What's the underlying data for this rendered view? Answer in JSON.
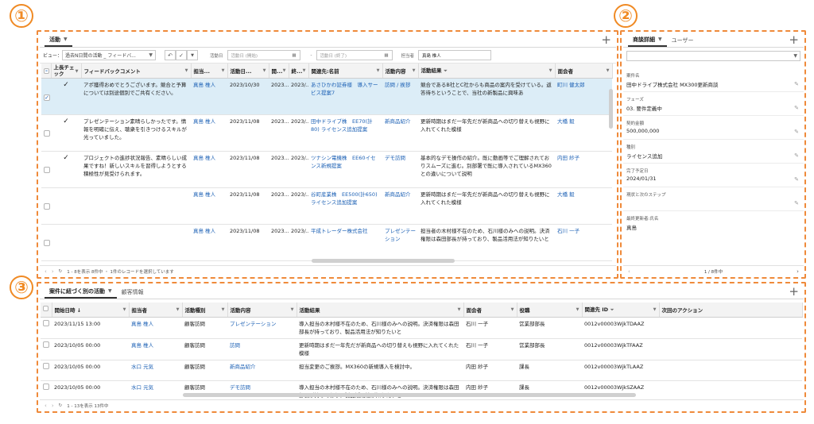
{
  "badges": [
    "①",
    "②",
    "③"
  ],
  "activity_panel": {
    "tab_label": "活動",
    "view_label": "ビュー：",
    "view_value": "過去N日間の活動 _ フィードバ...",
    "date_label": "活動日",
    "date_start_placeholder": "活動日 (開始)",
    "date_range_sep": "-",
    "date_end_placeholder": "活動日 (終了)",
    "owner_label": "担当者",
    "owner_value": "真島 椎人",
    "columns": [
      "",
      "上長チェック",
      "フィードバックコメント",
      "担当...",
      "活動日...",
      "開...",
      "終...",
      "関連先:名前",
      "活動内容",
      "活動結果",
      "面会者"
    ],
    "rows": [
      {
        "check": "✓",
        "comment": "アポ獲得おめでとうございます。競合と予算については別途個別でご共有ください。",
        "owner": "真島 椎人",
        "date": "2023/10/30",
        "start": "2023...",
        "end": "2023/...",
        "related": "あさひかわ証券様　導入サービス提案7",
        "content": "訪問 / 挨拶",
        "result": "競合であるB社とC社からも商品の案内を受けている。返答待ちということで、当社の新製品に興味あ",
        "met": "町川 健太郎",
        "selected": true
      },
      {
        "check": "✓",
        "comment": "プレゼンテーション素晴らしかったです。情報を明確に伝え、聴衆を引きつけるスキルが光っていました。",
        "owner": "真島 椎人",
        "date": "2023/11/08",
        "start": "2023...",
        "end": "2023/...",
        "related": "田中ドライブ株　EE70(計80) ライセンス追加提案",
        "content": "新商品紹介",
        "result": "更新時期はまだ一年先だが新商品への切り替えも視野に入れてくれた模様",
        "met": "大橋 毅",
        "selected": false
      },
      {
        "check": "✓",
        "comment": "プロジェクトの進捗状況報告、素晴らしい成果ですね！新しいスキルを習得しようとする積極性が見受けられます。",
        "owner": "真島 椎人",
        "date": "2023/11/08",
        "start": "2023...",
        "end": "2023/...",
        "related": "ツナシン電機株　EE60イセンス新規提案",
        "content": "デモ訪問",
        "result": "基本的なデモ操作の紹介。既に動画等でご理解されておりスムーズに進む。別部署で既に導入されているMX360との違いについて説明",
        "met": "内田 紗子",
        "selected": false
      },
      {
        "check": "",
        "comment": "",
        "owner": "真島 椎人",
        "date": "2023/11/08",
        "start": "2023...",
        "end": "2023/...",
        "related": "谷町産業株　EE500(計650) ライセンス追加提案",
        "content": "新商品紹介",
        "result": "更新時期はまだ一年先だが新商品への切り替えも視野に入れてくれた模様",
        "met": "大橋 毅",
        "selected": false
      },
      {
        "check": "",
        "comment": "",
        "owner": "真島 椎人",
        "date": "2023/11/08",
        "start": "2023...",
        "end": "2023/...",
        "related": "平成トレーダー株式会社",
        "content": "プレゼンテーション",
        "result": "担当者の木村様不在のため、石川様のみへの説明。決済権限は森田部長が持っており、製品活用法が知りたいと",
        "met": "石川 一子",
        "selected": false
      }
    ],
    "footer": "1 - 8を表示 8件中 ・ 1件のレコードを選択しています"
  },
  "detail_panel": {
    "tab_active": "商談詳細",
    "tab_other": "ユーザー",
    "fields": [
      {
        "label": "案件名",
        "value": "田中ドライブ株式会社 MX300更新商談"
      },
      {
        "label": "フェーズ",
        "value": "03. 要件定義中"
      },
      {
        "label": "契約金額",
        "value": "500,000,000"
      },
      {
        "label": "種別",
        "value": "ライセンス追加"
      },
      {
        "label": "完了予定日",
        "value": "2024/01/31"
      },
      {
        "label": "現状と次のステップ",
        "value": ""
      },
      {
        "label": "最終更新者:氏名",
        "value": "真島"
      }
    ],
    "footer": "1 / 8件中"
  },
  "related_panel": {
    "tab_active": "案件に紐づく別の活動",
    "tab_other": "顧客情報",
    "columns": [
      "",
      "開始日時 ↓",
      "担当者",
      "活動種別",
      "活動内容",
      "活動結果",
      "面会者",
      "役職",
      "関連先 ID",
      "次回のアクション"
    ],
    "rows": [
      {
        "start": "2023/11/15 13:00",
        "owner": "真島 椎人",
        "type": "顧客訪問",
        "content": "プレゼンテーション",
        "result": "導入担当の木村様不在のため、石川様のみへの説明。決済権限は森田部長が持っており、製品活用法が知りたいと",
        "met": "石川 一子",
        "title": "営業部部長",
        "rel_id": "0012v00003WjkTDAAZ",
        "next": ""
      },
      {
        "start": "2023/10/05 00:00",
        "owner": "真島 椎人",
        "type": "顧客訪問",
        "content": "訪問",
        "result": "更新時期はまだ一年先だが新商品への切り替えも視野に入れてくれた模様",
        "met": "石川 一子",
        "title": "営業部部長",
        "rel_id": "0012v00003WjkTFAAZ",
        "next": ""
      },
      {
        "start": "2023/10/05 00:00",
        "owner": "水口 元気",
        "type": "顧客訪問",
        "content": "新商品紹介",
        "result": "担当変更のご挨拶。MX360の新規導入を検討中。",
        "met": "内田 紗子",
        "title": "課長",
        "rel_id": "0012v00003WjkTLAAZ",
        "next": ""
      },
      {
        "start": "2023/10/05 00:00",
        "owner": "水口 元気",
        "type": "顧客訪問",
        "content": "デモ訪問",
        "result": "導入担当の木村様不在のため、石川様のみへの説明。決済権限は森田部長が持っており、製品活用法が知りたいと",
        "met": "内田 紗子",
        "title": "課長",
        "rel_id": "0012v00003WjkSZAAZ",
        "next": ""
      }
    ],
    "footer": "1 - 13を表示 13件中"
  }
}
